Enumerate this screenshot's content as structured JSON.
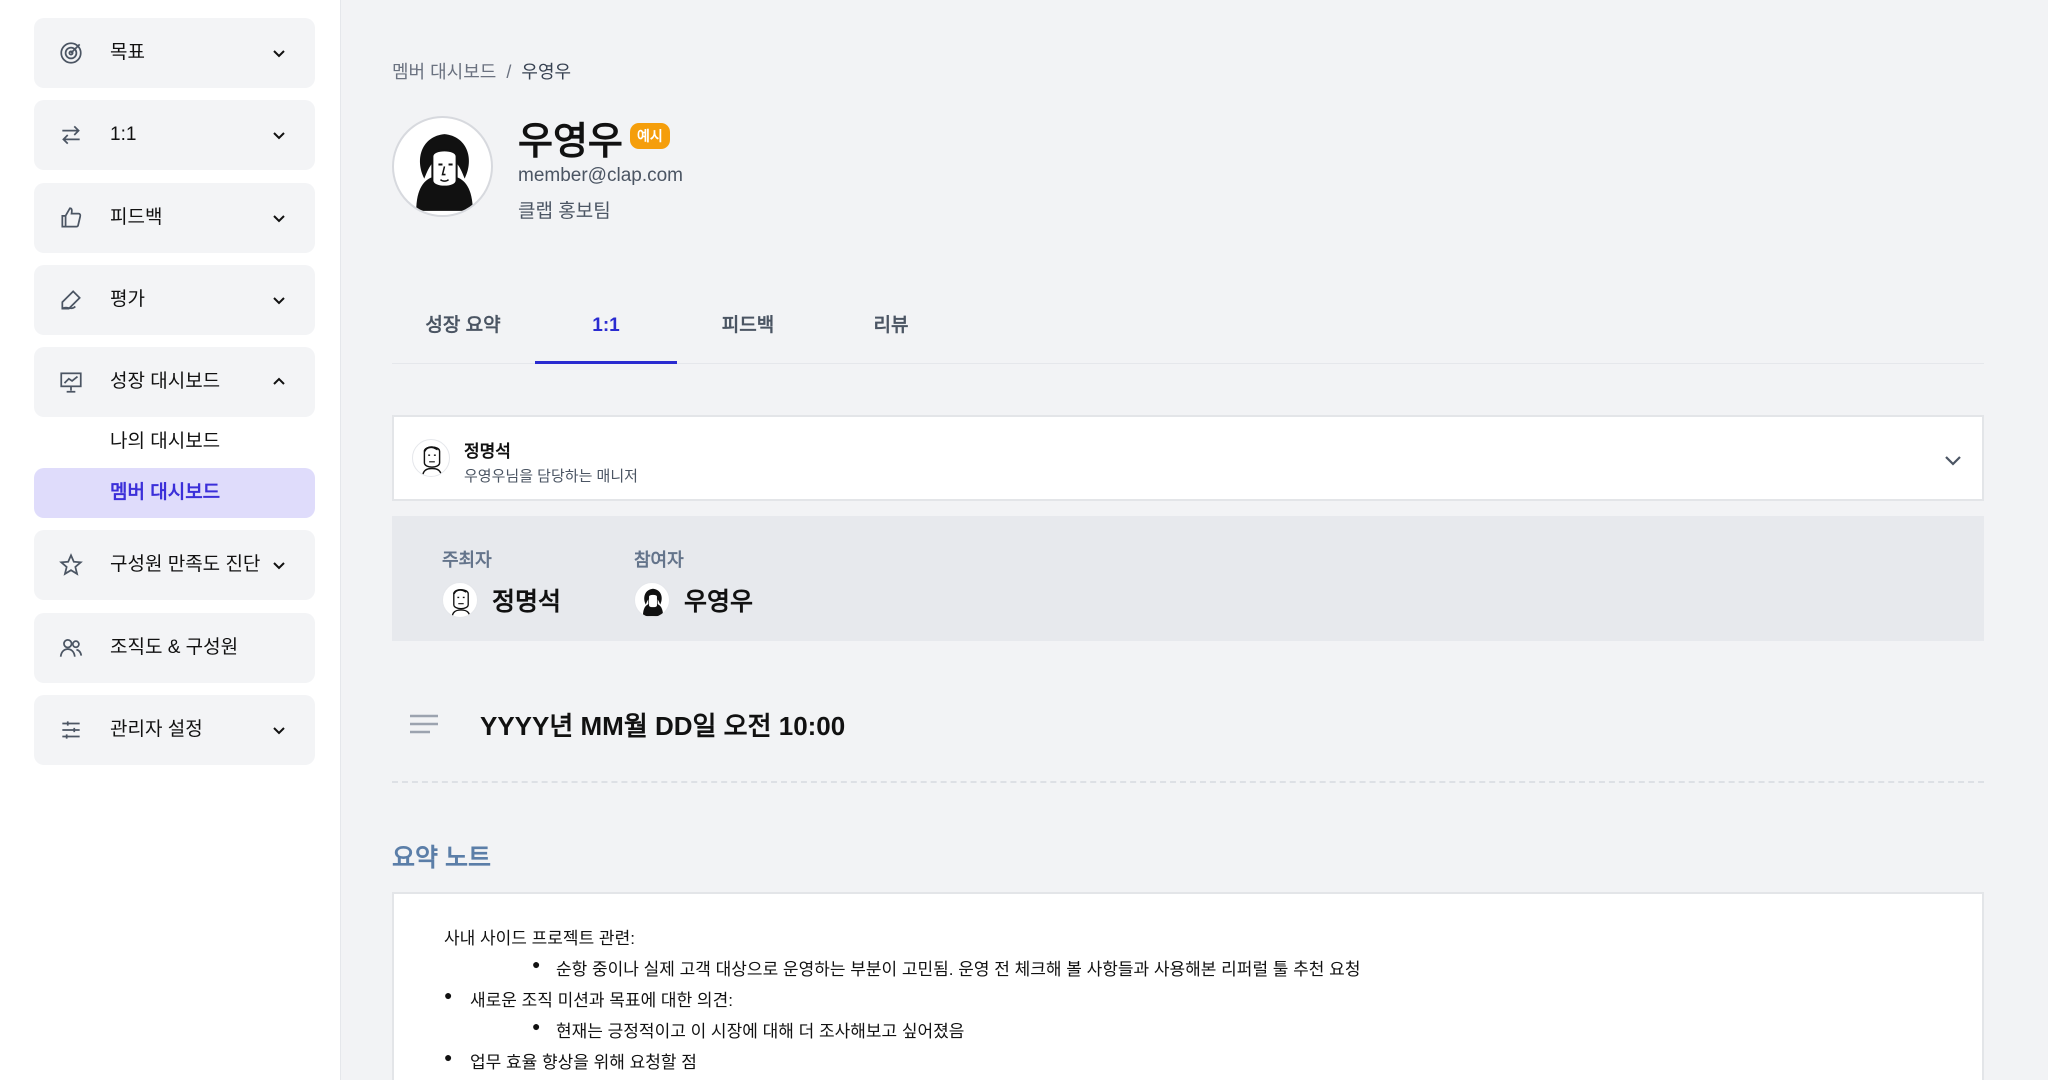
{
  "sidebar": {
    "items": [
      {
        "label": "목표",
        "icon": "target-icon"
      },
      {
        "label": "1:1",
        "icon": "swap-arrows-icon"
      },
      {
        "label": "피드백",
        "icon": "thumbs-up-icon"
      },
      {
        "label": "평가",
        "icon": "pen-icon"
      },
      {
        "label": "성장 대시보드",
        "icon": "presentation-chart-icon"
      },
      {
        "label": "구성원 만족도 진단",
        "icon": "star-icon"
      },
      {
        "label": "조직도 & 구성원",
        "icon": "users-icon"
      },
      {
        "label": "관리자 설정",
        "icon": "sliders-icon"
      }
    ],
    "sub_items": [
      {
        "label": "나의 대시보드"
      },
      {
        "label": "멤버 대시보드"
      }
    ]
  },
  "breadcrumb": {
    "parent": "멤버 대시보드",
    "separator": "/",
    "current": "우영우"
  },
  "profile": {
    "name": "우영우",
    "badge": "예시",
    "email": "member@clap.com",
    "team": "클랩 홍보팀"
  },
  "tabs": [
    {
      "label": "성장 요약"
    },
    {
      "label": "1:1"
    },
    {
      "label": "피드백"
    },
    {
      "label": "리뷰"
    }
  ],
  "manager": {
    "name": "정명석",
    "subtitle": "우영우님을 담당하는 매니저"
  },
  "participants": {
    "host_label": "주최자",
    "host_name": "정명석",
    "attendee_label": "참여자",
    "attendee_name": "우영우"
  },
  "meeting": {
    "datetime": "YYYY년 MM월 DD일 오전 10:00"
  },
  "notes": {
    "title": "요약 노트",
    "lines": [
      "사내 사이드 프로젝트 관련:",
      "순항 중이나 실제 고객 대상으로 운영하는 부분이 고민됨. 운영 전 체크해 볼 사항들과 사용해본 리퍼럴 툴 추천 요청",
      "새로운 조직 미션과 목표에 대한 의견:",
      "현재는 긍정적이고 이 시장에 대해 더 조사해보고 싶어졌음",
      "업무 효율 향상을 위해 요청할 점"
    ]
  },
  "colors": {
    "accent": "#2a2bd0",
    "active_sub_bg": "#dfdcfb",
    "badge": "#f59e0b",
    "notes_title": "#5b7ea8"
  }
}
